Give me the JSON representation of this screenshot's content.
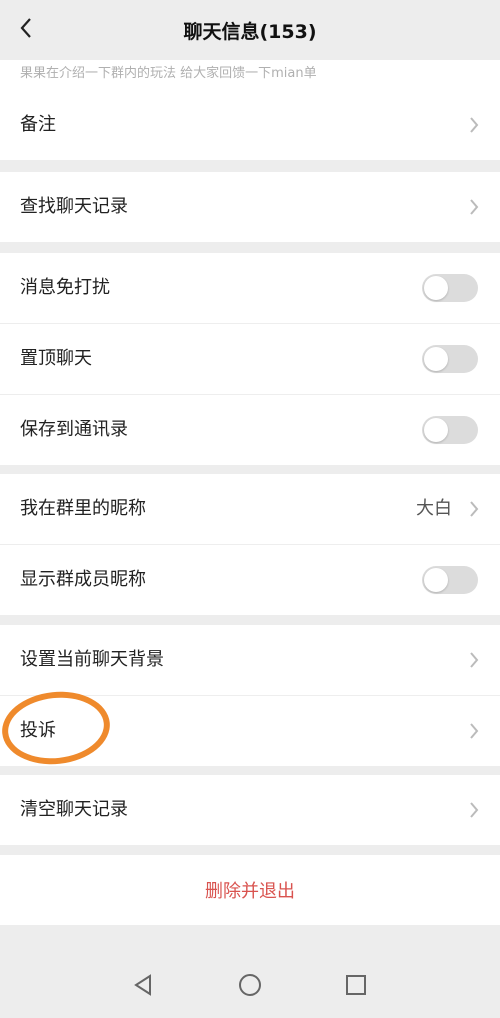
{
  "header": {
    "title": "聊天信息(153)",
    "back_icon": "chevron-left-icon"
  },
  "announcement": {
    "text_tail": "果果在介绍一下群内的玩法 给大家回馈一下mian单"
  },
  "groups": {
    "remark": {
      "label": "备注"
    },
    "search_history": {
      "label": "查找聊天记录"
    },
    "mute": {
      "label": "消息免打扰",
      "on": false
    },
    "pin": {
      "label": "置顶聊天",
      "on": false
    },
    "save_contacts": {
      "label": "保存到通讯录",
      "on": false
    },
    "my_nickname": {
      "label": "我在群里的昵称",
      "value": "大白"
    },
    "show_nicknames": {
      "label": "显示群成员昵称",
      "on": false
    },
    "background": {
      "label": "设置当前聊天背景"
    },
    "complain": {
      "label": "投诉"
    },
    "clear_history": {
      "label": "清空聊天记录"
    }
  },
  "danger": {
    "delete_exit_label": "删除并退出"
  },
  "colors": {
    "accent_circle": "#ef8a2c",
    "danger_text": "#d9534f",
    "toggle_off": "#dcdcdc"
  },
  "navbar": {
    "icons": [
      "back-triangle-icon",
      "home-circle-icon",
      "recents-square-icon"
    ]
  }
}
